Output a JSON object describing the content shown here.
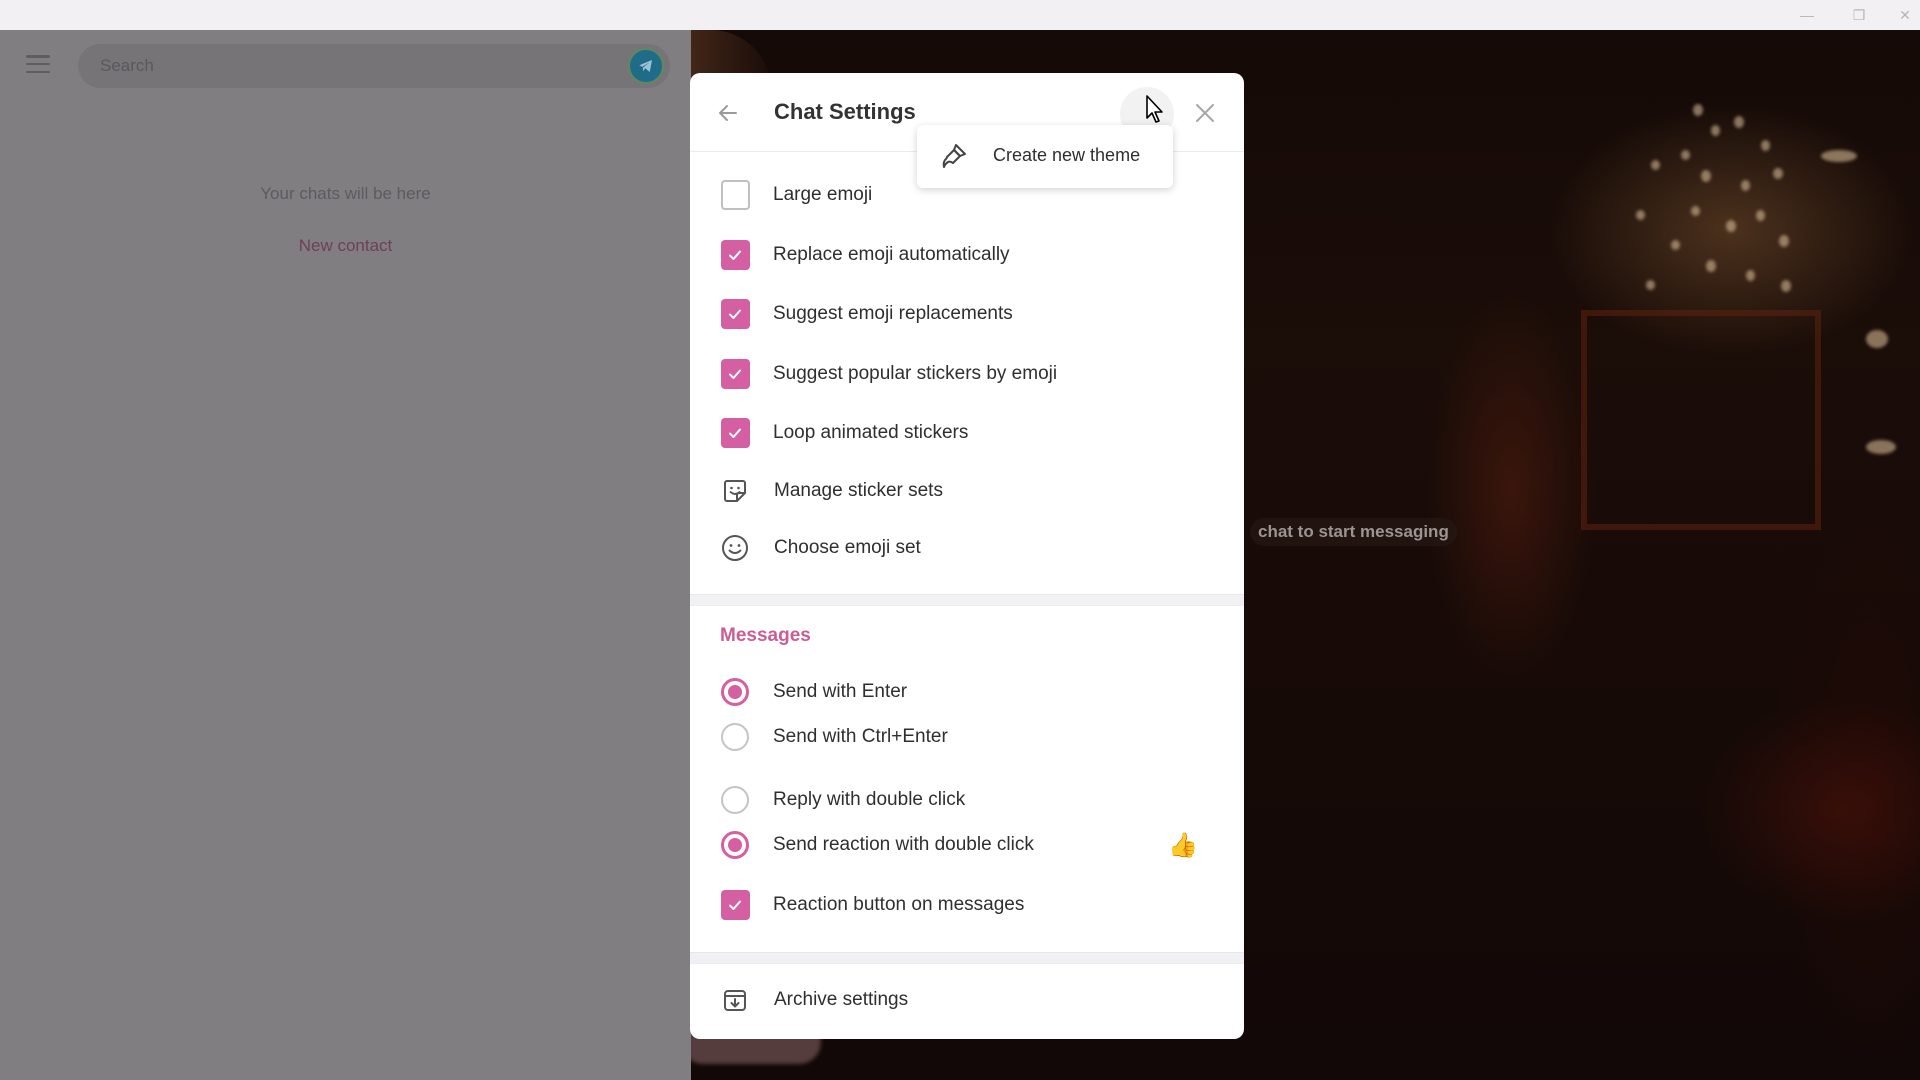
{
  "window": {
    "controls": {
      "minimize": "—",
      "maximize": "❐",
      "close": "✕"
    }
  },
  "sidebar": {
    "menu_icon": "hamburger-menu-icon",
    "search": {
      "placeholder": "Search",
      "value": ""
    },
    "logo_icon": "telegram-logo-icon",
    "empty_text": "Your chats will be here",
    "new_contact_label": "New contact"
  },
  "main": {
    "hint_text": "chat to start messaging"
  },
  "dialog": {
    "title": "Chat Settings",
    "back_icon": "arrow-left-icon",
    "more_icon": "more-options-icon",
    "close_icon": "close-icon",
    "emoji_section": {
      "checkboxes": [
        {
          "label": "Large emoji",
          "checked": false
        },
        {
          "label": "Replace emoji automatically",
          "checked": true
        },
        {
          "label": "Suggest emoji replacements",
          "checked": true
        },
        {
          "label": "Suggest popular stickers by emoji",
          "checked": true
        },
        {
          "label": "Loop animated stickers",
          "checked": true
        }
      ],
      "links": [
        {
          "label": "Manage sticker sets",
          "icon": "sticker-icon"
        },
        {
          "label": "Choose emoji set",
          "icon": "smile-icon"
        }
      ]
    },
    "messages_section": {
      "title": "Messages",
      "send_options": [
        {
          "label": "Send with Enter",
          "selected": true
        },
        {
          "label": "Send with Ctrl+Enter",
          "selected": false
        }
      ],
      "double_click_options": [
        {
          "label": "Reply with double click",
          "selected": false
        },
        {
          "label": "Send reaction with double click",
          "selected": true,
          "reaction": "👍"
        }
      ],
      "reaction_button": {
        "label": "Reaction button on messages",
        "checked": true
      }
    },
    "archive": {
      "label": "Archive settings",
      "icon": "archive-icon"
    }
  },
  "popup_menu": {
    "items": [
      {
        "label": "Create new theme",
        "icon": "brush-icon"
      }
    ]
  },
  "colors": {
    "accent": "#d45fa3",
    "section_title": "#cc5c95",
    "text": "#2f2f2f",
    "overlay": "#807e81"
  }
}
